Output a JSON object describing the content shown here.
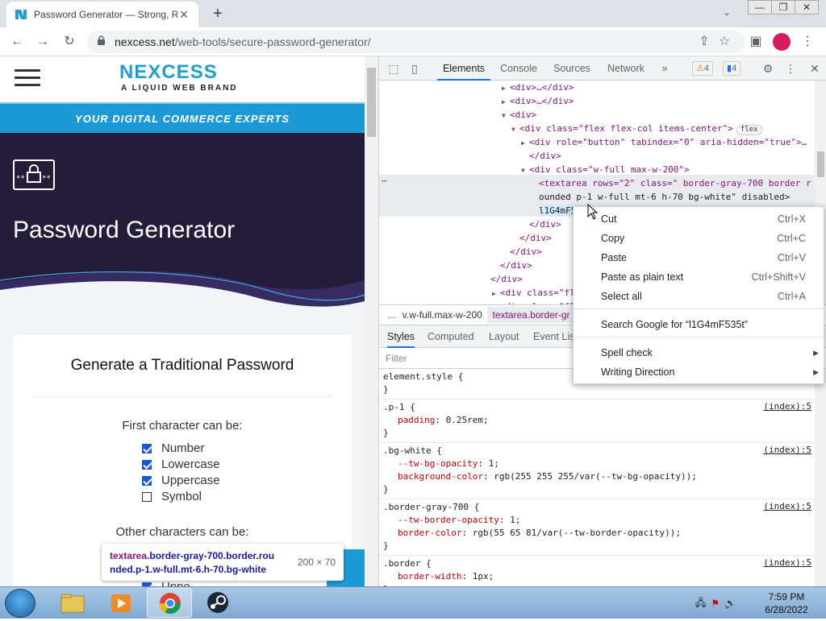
{
  "browser": {
    "tab_title": "Password Generator — Strong, R",
    "tab_close": "✕",
    "new_tab": "+",
    "url_host": "nexcess.net",
    "url_path": "/web-tools/secure-password-generator/",
    "window_controls": [
      "—",
      "❐",
      "✕"
    ]
  },
  "page": {
    "logo_text": "NEXCESS",
    "logo_sub": "A LIQUID WEB BRAND",
    "band_text": "YOUR DIGITAL COMMERCE EXPERTS",
    "hero_title": "Password Generator",
    "card_title": "Generate a Traditional Password",
    "first_char_label": "First character can be:",
    "first_char_options": [
      {
        "label": "Number",
        "checked": true
      },
      {
        "label": "Lowercase",
        "checked": true
      },
      {
        "label": "Uppercase",
        "checked": true
      },
      {
        "label": "Symbol",
        "checked": false
      }
    ],
    "other_chars_label": "Other characters can be:",
    "partial_option": "Uppe",
    "tooltip_selector_1": "textarea",
    "tooltip_selector_2": ".border-gray-700.border.rou",
    "tooltip_selector_3": "nded.p-1.w-full.mt-6.h-70.bg-white",
    "tooltip_dims": "200 × 70"
  },
  "devtools": {
    "tabs": [
      "Elements",
      "Console",
      "Sources",
      "Network"
    ],
    "more_tabs": "»",
    "warnings": "4",
    "messages": "4",
    "dom": [
      {
        "indent": 8,
        "tri": "▶",
        "html": "<div>…</div>"
      },
      {
        "indent": 8,
        "tri": "▶",
        "html": "<div>…</div>"
      },
      {
        "indent": 8,
        "tri": "▼",
        "html": "<div>"
      },
      {
        "indent": 9,
        "tri": "▼",
        "html": "<div class=\"flex flex-col items-center\">"
      },
      {
        "indent": 10,
        "tri": "▶",
        "html": "<div role=\"button\" tabindex=\"0\" aria-hidden=\"true\">…"
      },
      {
        "indent": 10,
        "tri": "",
        "html": "</div>"
      },
      {
        "indent": 10,
        "tri": "▼",
        "html": "<div class=\"w-full max-w-200\">"
      },
      {
        "indent": 11,
        "tri": "",
        "html": "<textarea rows=\"2\" class=\" border-gray-700 border r"
      },
      {
        "indent": 11,
        "tri": "",
        "html": "ounded p-1 w-full mt-6 h-70 bg-white\" disabled>"
      },
      {
        "indent": 11,
        "tri": "",
        "html": "l1G4mF535t"
      },
      {
        "indent": 10,
        "tri": "",
        "html": "</div>"
      },
      {
        "indent": 9,
        "tri": "",
        "html": "</div>"
      },
      {
        "indent": 8,
        "tri": "",
        "html": "</div>"
      },
      {
        "indent": 7,
        "tri": "",
        "html": "</div>"
      },
      {
        "indent": 6,
        "tri": "",
        "html": "</div>"
      },
      {
        "indent": 7,
        "tri": "▶",
        "html": "<div class=\"flex"
      },
      {
        "indent": 7,
        "tri": "▶",
        "html": "<div class=\"fle"
      }
    ],
    "flex_pill": "flex",
    "selected_text": "l1G4mF535t",
    "crumbs_dots": "…",
    "crumb_1": "v.w-full.max-w-200",
    "crumb_2": "textarea.border-gr",
    "subtabs": [
      "Styles",
      "Computed",
      "Layout",
      "Event List"
    ],
    "filter_placeholder": "Filter",
    "rules": [
      {
        "selector": "element.style {",
        "src": "",
        "decls": []
      },
      {
        "selector": ".p-1 {",
        "src": "(index):5",
        "decls": [
          {
            "prop": "padding",
            "val": "0.25rem;"
          }
        ]
      },
      {
        "selector": ".bg-white {",
        "src": "(index):5",
        "decls": [
          {
            "prop": "--tw-bg-opacity",
            "val": "1;"
          },
          {
            "prop": "background-color",
            "val": "rgb(255 255 255/var(--tw-bg-opacity));"
          }
        ]
      },
      {
        "selector": ".border-gray-700 {",
        "src": "(index):5",
        "decls": [
          {
            "prop": "--tw-border-opacity",
            "val": "1;"
          },
          {
            "prop": "border-color",
            "val": "rgb(55 65 81/var(--tw-border-opacity));"
          }
        ]
      },
      {
        "selector": ".border {",
        "src": "(index):5",
        "decls": [
          {
            "prop": "border-width",
            "val": "1px;"
          }
        ]
      }
    ]
  },
  "context_menu": {
    "items": [
      {
        "label": "Cut",
        "shortcut": "Ctrl+X",
        "submenu": false
      },
      {
        "label": "Copy",
        "shortcut": "Ctrl+C",
        "submenu": false
      },
      {
        "label": "Paste",
        "shortcut": "Ctrl+V",
        "submenu": false
      },
      {
        "label": "Paste as plain text",
        "shortcut": "Ctrl+Shift+V",
        "submenu": false
      },
      {
        "label": "Select all",
        "shortcut": "Ctrl+A",
        "submenu": false
      },
      {
        "label": "Search Google for “l1G4mF535t”",
        "shortcut": "",
        "submenu": false
      },
      {
        "label": "Spell check",
        "shortcut": "",
        "submenu": true
      },
      {
        "label": "Writing Direction",
        "shortcut": "",
        "submenu": true
      }
    ]
  },
  "taskbar": {
    "time": "7:59 PM",
    "date": "6/28/2022"
  },
  "colors": {
    "brand": "#1e9fcf",
    "hero_bg": "#231d3a",
    "band": "#1c9ad6",
    "devtools_accent": "#1a73e8"
  }
}
